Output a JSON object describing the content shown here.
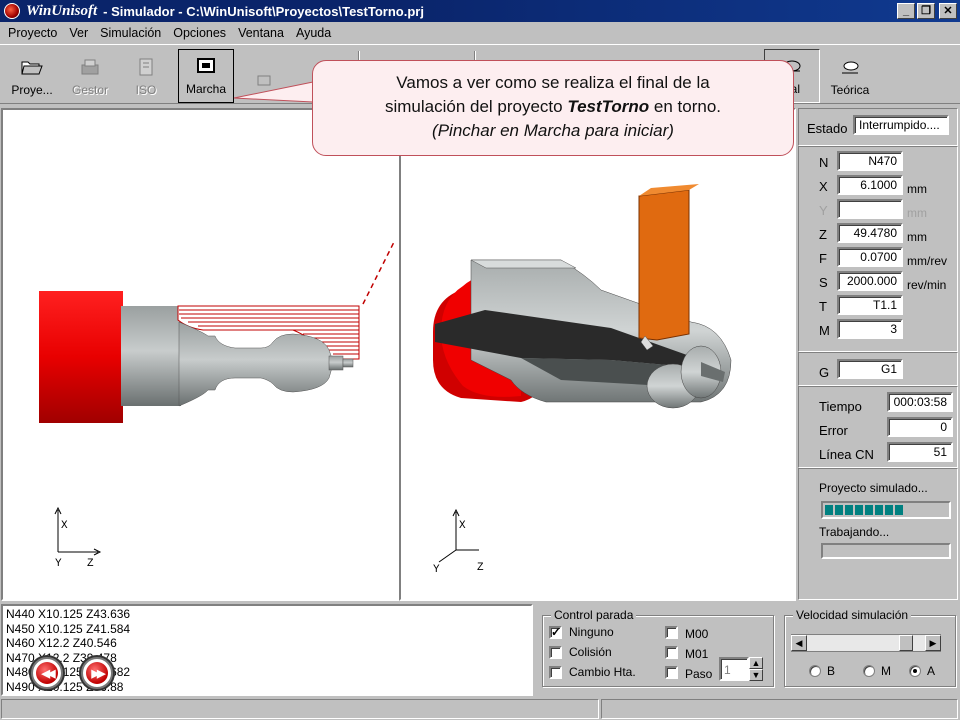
{
  "window": {
    "brand": "WinUnisoft",
    "title": "- Simulador - C:\\WinUnisoft\\Proyectos\\TestTorno.prj",
    "controls": [
      "_",
      "❐",
      "✕"
    ]
  },
  "menu": [
    "Proyecto",
    "Ver",
    "Simulación",
    "Opciones",
    "Ventana",
    "Ayuda"
  ],
  "toolbar": {
    "proyecto": "Proye...",
    "gestor": "Gestor",
    "iso": "ISO",
    "marcha": "Marcha",
    "real": "eal",
    "teorica": "Teórica"
  },
  "callout": {
    "line1": "Vamos a ver como se realiza el final de la",
    "line2_pre": "simulación del proyecto ",
    "line2_bold": "TestTorno",
    "line2_post": " en torno.",
    "line3": "(Pinchar en Marcha para iniciar)"
  },
  "axes": {
    "x": "X",
    "y": "Y",
    "z": "Z"
  },
  "status_panel": {
    "estado_label": "Estado",
    "estado_value": "Interrumpido....",
    "N": {
      "label": "N",
      "value": "N470"
    },
    "X": {
      "label": "X",
      "value": "6.1000",
      "unit": "mm"
    },
    "Y": {
      "label": "Y",
      "value": "",
      "unit": "mm"
    },
    "Z": {
      "label": "Z",
      "value": "49.4780",
      "unit": "mm"
    },
    "F": {
      "label": "F",
      "value": "0.0700",
      "unit": "mm/rev"
    },
    "S": {
      "label": "S",
      "value": "2000.000",
      "unit": "rev/min"
    },
    "T": {
      "label": "T",
      "value": "T1.1"
    },
    "M": {
      "label": "M",
      "value": "3"
    },
    "G": {
      "label": "G",
      "value": "G1"
    },
    "tiempo": {
      "label": "Tiempo",
      "value": "000:03:58"
    },
    "error": {
      "label": "Error",
      "value": "0"
    },
    "linea": {
      "label": "Línea CN",
      "value": "51"
    },
    "proyecto_simulado": "Proyecto simulado...",
    "trabajando": "Trabajando...",
    "progress_blocks": 8
  },
  "code_lines": [
    "N440 X10.125 Z43.636",
    "N450 X10.125 Z41.584",
    "N460 X12.2 Z40.546",
    "N470 X12.2 Z39.478",
    "N480 X10.125 Z38.682",
    "N490 X10.125 Z36.88"
  ],
  "control_parada": {
    "title": "Control parada",
    "ninguno": "Ninguno",
    "colision": "Colisión",
    "cambio": "Cambio Hta.",
    "m00": "M00",
    "m01": "M01",
    "paso": "Paso",
    "paso_value": "1"
  },
  "velocidad": {
    "title": "Velocidad simulación",
    "b": "B",
    "m": "M",
    "a": "A",
    "selected": "A"
  },
  "colors": {
    "part_red": "#e00000",
    "tool_orange": "#e06a10",
    "teal": "#008080"
  }
}
